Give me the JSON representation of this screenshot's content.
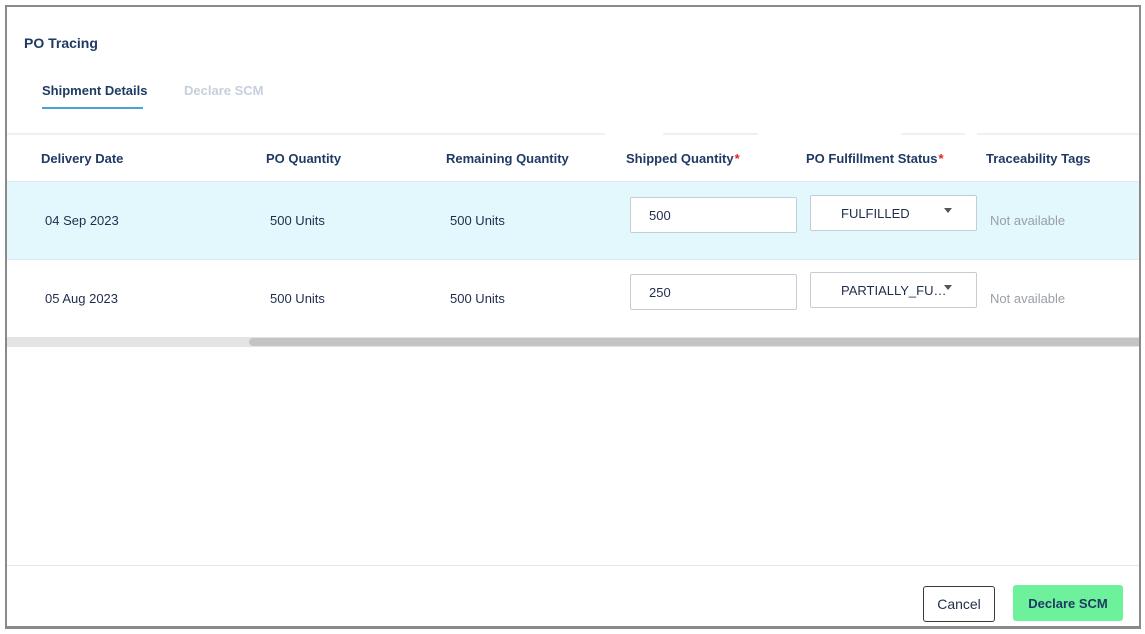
{
  "dialog": {
    "title": "PO Tracing"
  },
  "tabs": [
    {
      "label": "Shipment Details",
      "active": true
    },
    {
      "label": "Declare SCM",
      "active": false
    }
  ],
  "table": {
    "columns": [
      {
        "label": "Delivery Date",
        "required": false
      },
      {
        "label": "PO Quantity",
        "required": false
      },
      {
        "label": "Remaining Quantity",
        "required": false
      },
      {
        "label": "Shipped Quantity",
        "required": true
      },
      {
        "label": "PO Fulfillment Status",
        "required": true
      },
      {
        "label": "Traceability Tags",
        "required": false
      }
    ],
    "required_mark": "*",
    "rows": [
      {
        "delivery_date": "04 Sep 2023",
        "po_quantity": "500 Units",
        "remaining_quantity": "500 Units",
        "shipped_quantity": "500",
        "fulfillment_status": "FULFILLED",
        "traceability_tags": "Not available"
      },
      {
        "delivery_date": "05 Aug 2023",
        "po_quantity": "500 Units",
        "remaining_quantity": "500 Units",
        "shipped_quantity": "250",
        "fulfillment_status": "PARTIALLY_FU…",
        "traceability_tags": "Not available"
      }
    ]
  },
  "scrollbar": {
    "horizontal_position": 0.21
  },
  "footer": {
    "cancel_label": "Cancel",
    "declare_label": "Declare SCM"
  },
  "colors": {
    "accent": "#4aa3d6",
    "primary_button": "#6df29b",
    "highlight_row": "#e3f8fc",
    "required": "#e02424"
  },
  "icons": {
    "dropdown": "caret-down-icon"
  }
}
